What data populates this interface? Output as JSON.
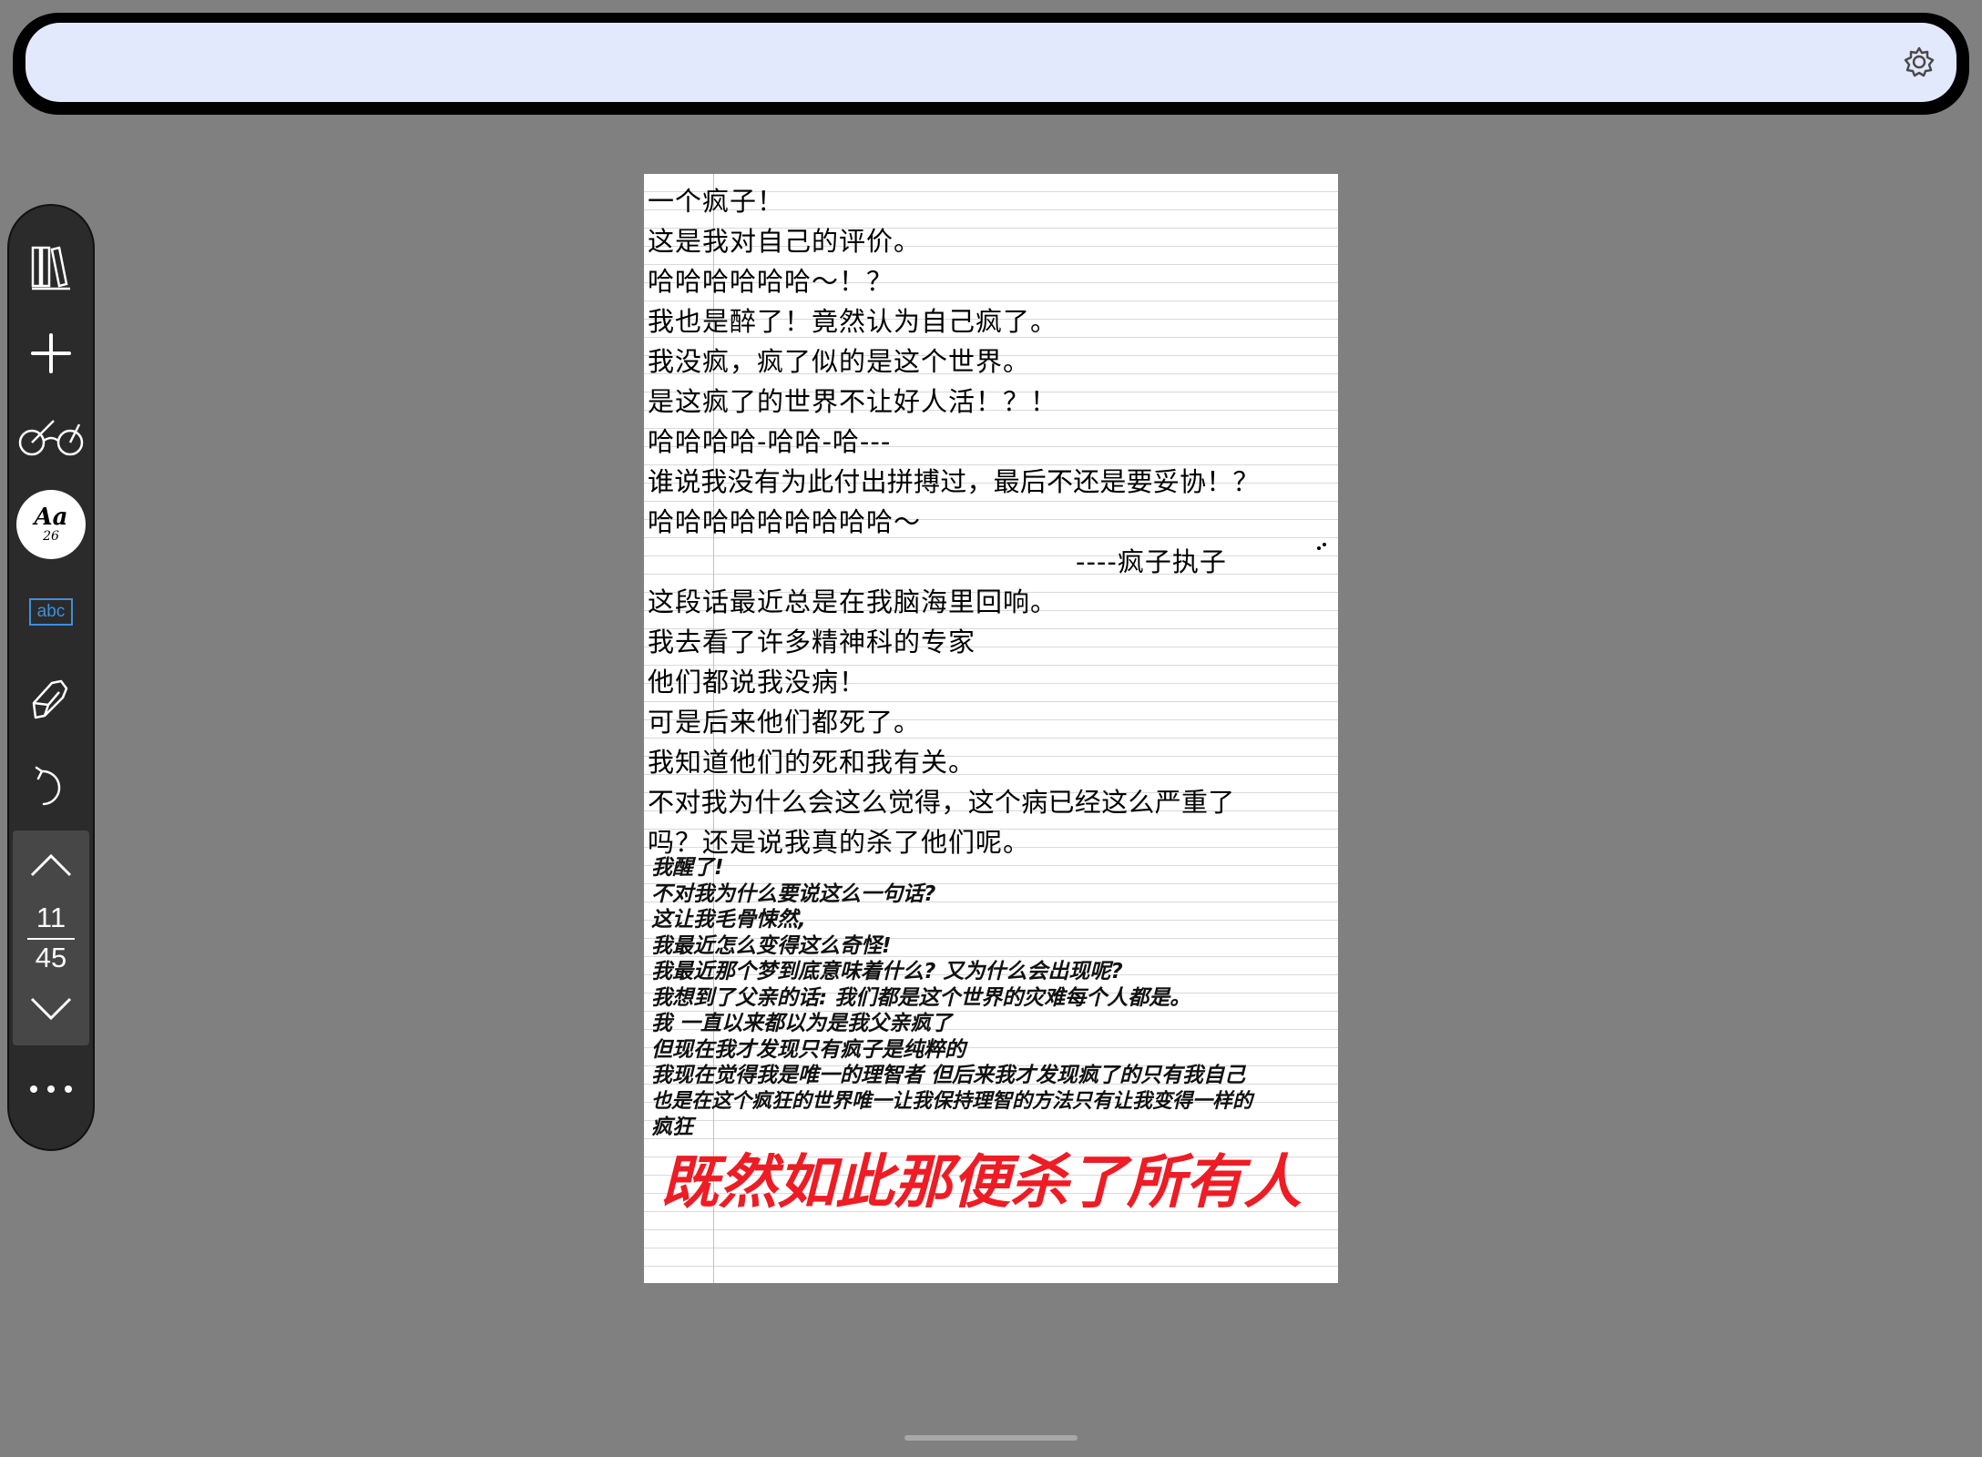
{
  "toolbar": {
    "font_button": {
      "label": "Aa",
      "size": "26"
    },
    "text_box_label": "abc",
    "page_current": "11",
    "page_total": "45"
  },
  "document": {
    "lines": [
      "一个疯子！",
      "这是我对自己的评价。",
      "哈哈哈哈哈哈～！？",
      "我也是醉了！竟然认为自己疯了。",
      "我没疯，疯了似的是这个世界。",
      "是这疯了的世界不让好人活！？！",
      "哈哈哈哈-哈哈-哈---",
      "谁说我没有为此付出拼搏过，最后不还是要妥协！？",
      "哈哈哈哈哈哈哈哈哈～",
      "----疯子执子",
      "这段话最近总是在我脑海里回响。",
      "我去看了许多精神科的专家",
      "他们都说我没病！",
      "可是后来他们都死了。",
      "我知道他们的死和我有关。",
      "不对我为什么会这么觉得，这个病已经这么严重了",
      "吗？还是说我真的杀了他们呢。"
    ],
    "italic_lines": [
      "我醒了!",
      "不对我为什么要说这么一句话?",
      "这让我毛骨悚然,",
      "我最近怎么变得这么奇怪!",
      "我最近那个梦到底意味着什么? 又为什么会出现呢?",
      "我想到了父亲的话: 我们都是这个世界的灾难每个人都是。",
      "我 一直以来都以为是我父亲疯了",
      "但现在我才发现只有疯子是纯粹的",
      "我现在觉得我是唯一的理智者 但后来我才发现疯了的只有我自己",
      "也是在这个疯狂的世界唯一让我保持理智的方法只有让我变得一样的",
      "疯狂"
    ],
    "red_text": "既然如此那便杀了所有人"
  },
  "colors": {
    "background": "#808080",
    "top_bar": "#e3e9fd",
    "toolbar": "#2b2b2b",
    "red_text": "#ee1c24",
    "abc_accent": "#3d8fe0"
  },
  "icons": [
    "library-icon",
    "plus-icon",
    "glasses-icon",
    "text-box-icon",
    "pen-icon",
    "undo-icon",
    "chevron-up-icon",
    "chevron-down-icon",
    "more-icon",
    "settings-icon"
  ]
}
